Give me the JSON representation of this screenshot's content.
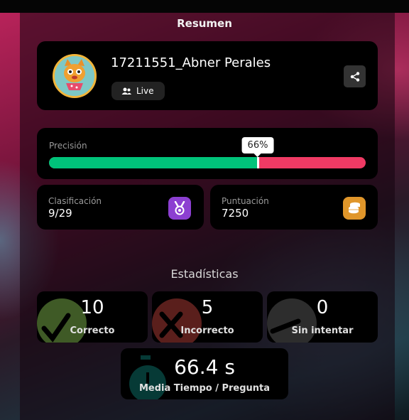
{
  "header": {
    "title": "Resumen"
  },
  "profile": {
    "username": "17211551_Abner Perales",
    "mode_label": "Live",
    "avatar_icon": "cat-avatar",
    "share_icon": "share-icon"
  },
  "accuracy": {
    "label": "Precisión",
    "percent_text": "66%",
    "percent_value": 66,
    "correct_color": "#00c37a",
    "incorrect_color": "#ef3a64"
  },
  "rank": {
    "label": "Clasificación",
    "value": "9/29",
    "icon": "medal-icon",
    "color": "#8c3fd1"
  },
  "score": {
    "label": "Puntuación",
    "value": "7250",
    "icon": "coins-icon",
    "color": "#e0962a"
  },
  "stats": {
    "title": "Estadísticas",
    "correct": {
      "value": "10",
      "label": "Correcto",
      "icon": "check-icon"
    },
    "incorrect": {
      "value": "5",
      "label": "Incorrecto",
      "icon": "cross-icon"
    },
    "unattempted": {
      "value": "0",
      "label": "Sin intentar",
      "icon": "minus-icon"
    },
    "avg_time": {
      "value": "66.4 s",
      "label": "Media Tiempo / Pregunta",
      "icon": "stopwatch-icon"
    }
  }
}
